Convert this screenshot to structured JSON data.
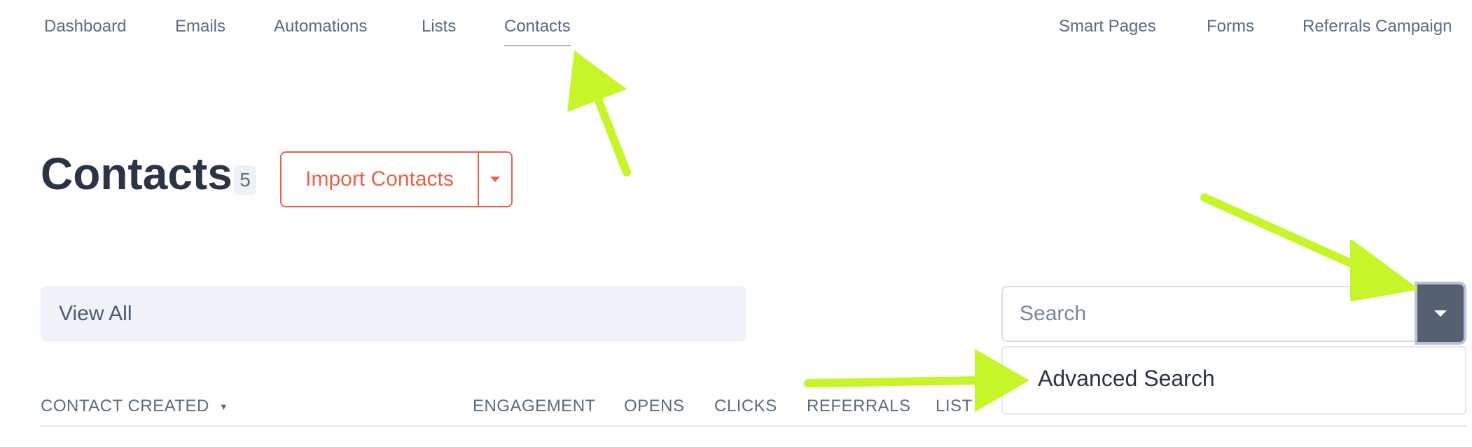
{
  "nav": {
    "left": [
      "Dashboard",
      "Emails",
      "Automations",
      "Lists",
      "Contacts"
    ],
    "right": [
      "Smart Pages",
      "Forms",
      "Referrals Campaign"
    ],
    "active": "Contacts"
  },
  "header": {
    "title": "Contacts",
    "count": "5",
    "import_label": "Import Contacts"
  },
  "filter": {
    "view_label": "View All"
  },
  "search": {
    "placeholder": "Search",
    "value": "",
    "dropdown_items": [
      "Advanced Search"
    ]
  },
  "table": {
    "columns": [
      "CONTACT CREATED",
      "ENGAGEMENT",
      "OPENS",
      "CLICKS",
      "REFERRALS",
      "LIST"
    ],
    "sorted_column": "CONTACT CREATED",
    "sort_indicator": "▼"
  },
  "colors": {
    "accent": "#e8624a",
    "annotation_arrow": "#c6f52a",
    "search_toggle": "#556070",
    "text_dark": "#2b3445",
    "text_muted": "#5a6b82"
  },
  "icons": {
    "import_dropdown": "caret-down-icon",
    "search_dropdown": "caret-down-icon",
    "sort": "sort-desc-icon",
    "annotations": "arrow-icon"
  }
}
